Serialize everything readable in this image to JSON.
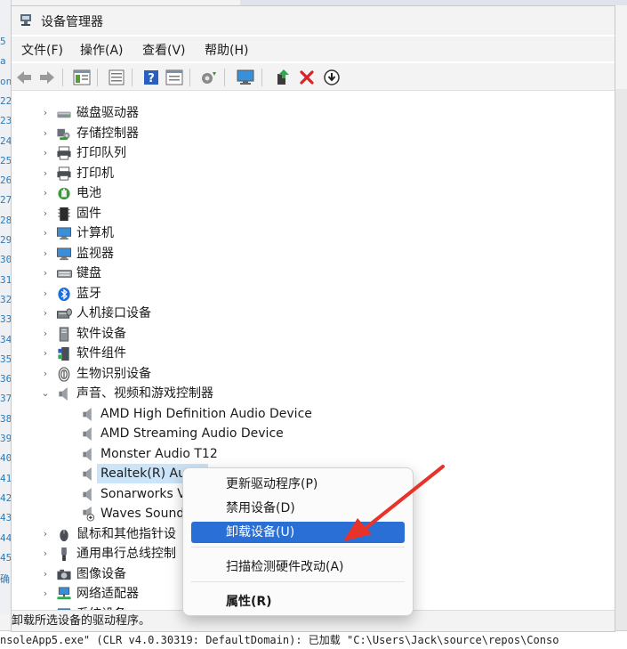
{
  "background": {
    "left_code_lines": [
      "5",
      "a",
      "on",
      "22",
      "23",
      "24",
      "25",
      "26",
      "27",
      "28",
      "29",
      "30",
      "31",
      "32",
      "33",
      "34",
      "35",
      "36",
      "37",
      "38",
      "39",
      "40",
      "41",
      "42",
      "43",
      "44",
      "45",
      "确"
    ],
    "bottom_console": "nsoleApp5.exe\" (CLR v4.0.30319: DefaultDomain): 已加载 \"C:\\Users\\Jack\\source\\repos\\Conso"
  },
  "window": {
    "title": "设备管理器",
    "menu": [
      "文件(F)",
      "操作(A)",
      "查看(V)",
      "帮助(H)"
    ],
    "status": "卸载所选设备的驱动程序。"
  },
  "toolbar": [
    "back-icon",
    "forward-icon",
    "properties-pane-icon",
    "device-view-icon",
    "help-icon",
    "show-hidden-icon",
    "scan-hardware-icon",
    "monitor-icon",
    "update-driver-icon",
    "uninstall-icon",
    "download-icon"
  ],
  "tree": {
    "categories": [
      {
        "label": "磁盘驱动器",
        "icon": "disk-drive-icon",
        "expanded": false
      },
      {
        "label": "存储控制器",
        "icon": "storage-controller-icon",
        "expanded": false
      },
      {
        "label": "打印队列",
        "icon": "print-queue-icon",
        "expanded": false
      },
      {
        "label": "打印机",
        "icon": "printer-icon",
        "expanded": false
      },
      {
        "label": "电池",
        "icon": "battery-icon",
        "expanded": false
      },
      {
        "label": "固件",
        "icon": "firmware-icon",
        "expanded": false
      },
      {
        "label": "计算机",
        "icon": "computer-icon",
        "expanded": false
      },
      {
        "label": "监视器",
        "icon": "monitor-icon",
        "expanded": false
      },
      {
        "label": "键盘",
        "icon": "keyboard-icon",
        "expanded": false
      },
      {
        "label": "蓝牙",
        "icon": "bluetooth-icon",
        "expanded": false
      },
      {
        "label": "人机接口设备",
        "icon": "hid-icon",
        "expanded": false
      },
      {
        "label": "软件设备",
        "icon": "software-device-icon",
        "expanded": false
      },
      {
        "label": "软件组件",
        "icon": "software-component-icon",
        "expanded": false
      },
      {
        "label": "生物识别设备",
        "icon": "biometric-icon",
        "expanded": false
      },
      {
        "label": "声音、视频和游戏控制器",
        "icon": "speaker-icon",
        "expanded": true
      }
    ],
    "audio_devices": [
      {
        "label": "AMD High Definition Audio Device",
        "selected": false
      },
      {
        "label": "AMD Streaming Audio Device",
        "selected": false
      },
      {
        "label": "Monster Audio T12",
        "selected": false
      },
      {
        "label": "Realtek(R) Audio",
        "selected": true
      },
      {
        "label": "Sonarworks V",
        "selected": false
      },
      {
        "label": "Waves Sound",
        "selected": false
      }
    ],
    "categories_after": [
      {
        "label": "鼠标和其他指针设",
        "icon": "mouse-icon",
        "expanded": false
      },
      {
        "label": "通用串行总线控制",
        "icon": "usb-icon",
        "expanded": false
      },
      {
        "label": "图像设备",
        "icon": "camera-icon",
        "expanded": false
      },
      {
        "label": "网络适配器",
        "icon": "network-icon",
        "expanded": false
      },
      {
        "label": "系统设备",
        "icon": "system-device-icon",
        "expanded": false
      }
    ]
  },
  "context_menu": {
    "items": [
      {
        "label": "更新驱动程序(P)",
        "highlighted": false,
        "bold": false
      },
      {
        "label": "禁用设备(D)",
        "highlighted": false,
        "bold": false
      },
      {
        "label": "卸载设备(U)",
        "highlighted": true,
        "bold": false
      },
      {
        "label": "扫描检测硬件改动(A)",
        "highlighted": false,
        "bold": false
      },
      {
        "label": "属性(R)",
        "highlighted": false,
        "bold": true
      }
    ],
    "highlight_color": "#2a6fd6"
  },
  "annotation": {
    "arrow_color": "#e8332a"
  }
}
